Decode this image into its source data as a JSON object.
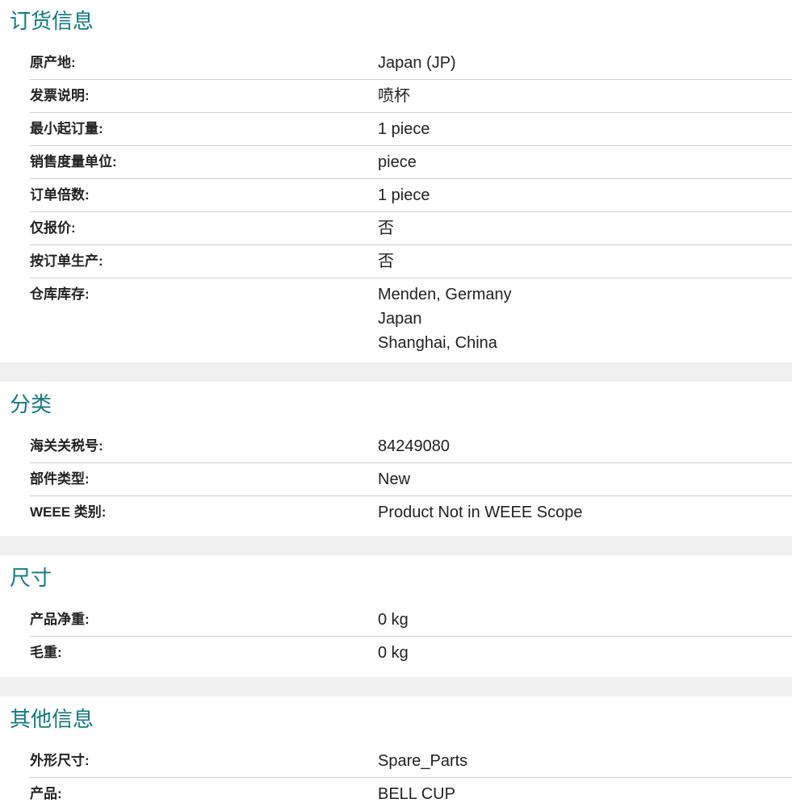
{
  "sections": [
    {
      "title": "订货信息",
      "rows": [
        {
          "label": "原产地:",
          "value": [
            "Japan (JP)"
          ]
        },
        {
          "label": "发票说明:",
          "value": [
            "喷杯"
          ]
        },
        {
          "label": "最小起订量:",
          "value": [
            "1 piece"
          ]
        },
        {
          "label": "销售度量单位:",
          "value": [
            "piece"
          ]
        },
        {
          "label": "订单倍数:",
          "value": [
            "1 piece"
          ]
        },
        {
          "label": "仅报价:",
          "value": [
            "否"
          ]
        },
        {
          "label": "按订单生产:",
          "value": [
            "否"
          ]
        },
        {
          "label": "仓库库存:",
          "value": [
            "Menden, Germany",
            "Japan",
            "Shanghai, China"
          ]
        }
      ]
    },
    {
      "title": "分类",
      "rows": [
        {
          "label": "海关关税号:",
          "value": [
            "84249080"
          ]
        },
        {
          "label": "部件类型:",
          "value": [
            "New"
          ]
        },
        {
          "label": "WEEE 类别:",
          "value": [
            "Product Not in WEEE Scope"
          ]
        }
      ]
    },
    {
      "title": "尺寸",
      "rows": [
        {
          "label": "产品净重:",
          "value": [
            "0 kg"
          ]
        },
        {
          "label": "毛重:",
          "value": [
            "0 kg"
          ]
        }
      ]
    },
    {
      "title": "其他信息",
      "rows": [
        {
          "label": "外形尺寸:",
          "value": [
            "Spare_Parts"
          ]
        },
        {
          "label": "产品:",
          "value": [
            "BELL CUP"
          ]
        }
      ]
    }
  ]
}
